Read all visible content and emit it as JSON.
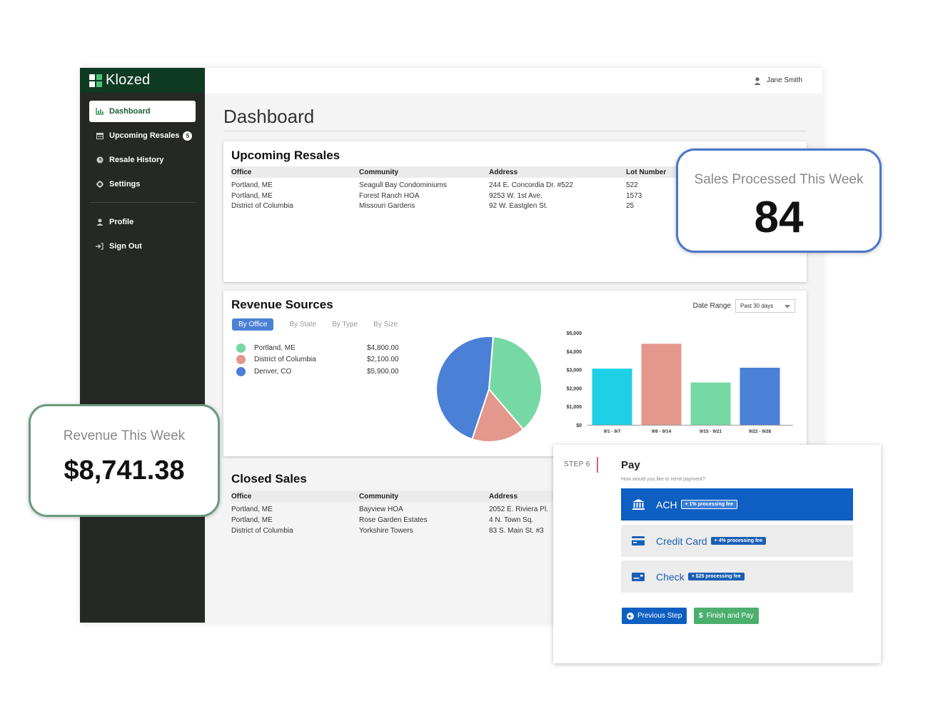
{
  "brand": {
    "name": "Klozed"
  },
  "user": {
    "name": "Jane Smith"
  },
  "sidebar": {
    "items": [
      {
        "label": "Dashboard",
        "icon": "bar-chart-icon",
        "active": true
      },
      {
        "label": "Upcoming Resales",
        "icon": "calendar-icon",
        "badge": "5"
      },
      {
        "label": "Resale History",
        "icon": "clock-icon"
      },
      {
        "label": "Settings",
        "icon": "gear-icon"
      }
    ],
    "items2": [
      {
        "label": "Profile",
        "icon": "user-icon"
      },
      {
        "label": "Sign Out",
        "icon": "sign-out-icon"
      }
    ]
  },
  "page": {
    "title": "Dashboard"
  },
  "upcoming": {
    "title": "Upcoming Resales",
    "columns": [
      "Office",
      "Community",
      "Address",
      "Lot Number"
    ],
    "rows": [
      [
        "Portland, ME",
        "Seagull Bay Condominiums",
        "244 E. Concordia Dr. #522",
        "522"
      ],
      [
        "Portland, ME",
        "Forest Ranch HOA",
        "9253 W. 1st Ave.",
        "1573"
      ],
      [
        "District of Columbia",
        "Missouri Gardens",
        "92 W. Eastglen St.",
        "25"
      ]
    ]
  },
  "revenue": {
    "title": "Revenue Sources",
    "tabs": [
      "By Office",
      "By State",
      "By Type",
      "By Size"
    ],
    "date_range_label": "Date Range",
    "date_range_value": "Past 30 days",
    "legend": [
      {
        "name": "Portland, ME",
        "value": "$4,800.00",
        "color": "#76d9a4"
      },
      {
        "name": "District of Columbia",
        "value": "$2,100.00",
        "color": "#e3978d"
      },
      {
        "name": "Denver, CO",
        "value": "$5,900.00",
        "color": "#4a80d6"
      }
    ]
  },
  "closed": {
    "title": "Closed Sales",
    "columns": [
      "Office",
      "Community",
      "Address"
    ],
    "rows": [
      [
        "Portland, ME",
        "Bayview HOA",
        "2052 E. Riviera Pl."
      ],
      [
        "Portland, ME",
        "Rose Garden Estates",
        "4 N. Town Sq."
      ],
      [
        "District of Columbia",
        "Yorkshire Towers",
        "83 S. Main St. #3"
      ]
    ]
  },
  "sales_callout": {
    "label": "Sales Processed This Week",
    "value": "84",
    "border_color": "#4a76c9"
  },
  "revenue_callout": {
    "label": "Revenue This Week",
    "value": "$8,741.38",
    "border_color": "#6a9a7e"
  },
  "pay": {
    "step": "STEP 6",
    "title": "Pay",
    "subtitle": "How would you like to remit payment?",
    "options": [
      {
        "label": "ACH",
        "fee": "+ 1% processing fee",
        "icon": "bank-icon",
        "selected": true
      },
      {
        "label": "Credit Card",
        "fee": "+ 4% processing fee",
        "icon": "credit-card-icon"
      },
      {
        "label": "Check",
        "fee": "+ $25 processing fee",
        "icon": "check-icon"
      }
    ],
    "prev_label": "Previous Step",
    "finish_label": "Finish and Pay"
  },
  "chart_data": [
    {
      "type": "pie",
      "categories": [
        "Portland, ME",
        "District of Columbia",
        "Denver, CO"
      ],
      "values": [
        4800,
        2100,
        5900
      ],
      "colors": [
        "#76d9a4",
        "#e3978d",
        "#4a80d6"
      ]
    },
    {
      "type": "bar",
      "categories": [
        "9/1 - 9/7",
        "9/8 - 9/14",
        "9/15 - 9/21",
        "9/22 - 9/28"
      ],
      "values": [
        3050,
        4400,
        2300,
        3100
      ],
      "colors": [
        "#1ed0e6",
        "#e3978d",
        "#76d9a4",
        "#4a80d6"
      ],
      "ylim": [
        0,
        5000
      ],
      "yticks": [
        "$0",
        "$1,000",
        "$2,000",
        "$3,000",
        "$4,000",
        "$5,000"
      ]
    }
  ]
}
